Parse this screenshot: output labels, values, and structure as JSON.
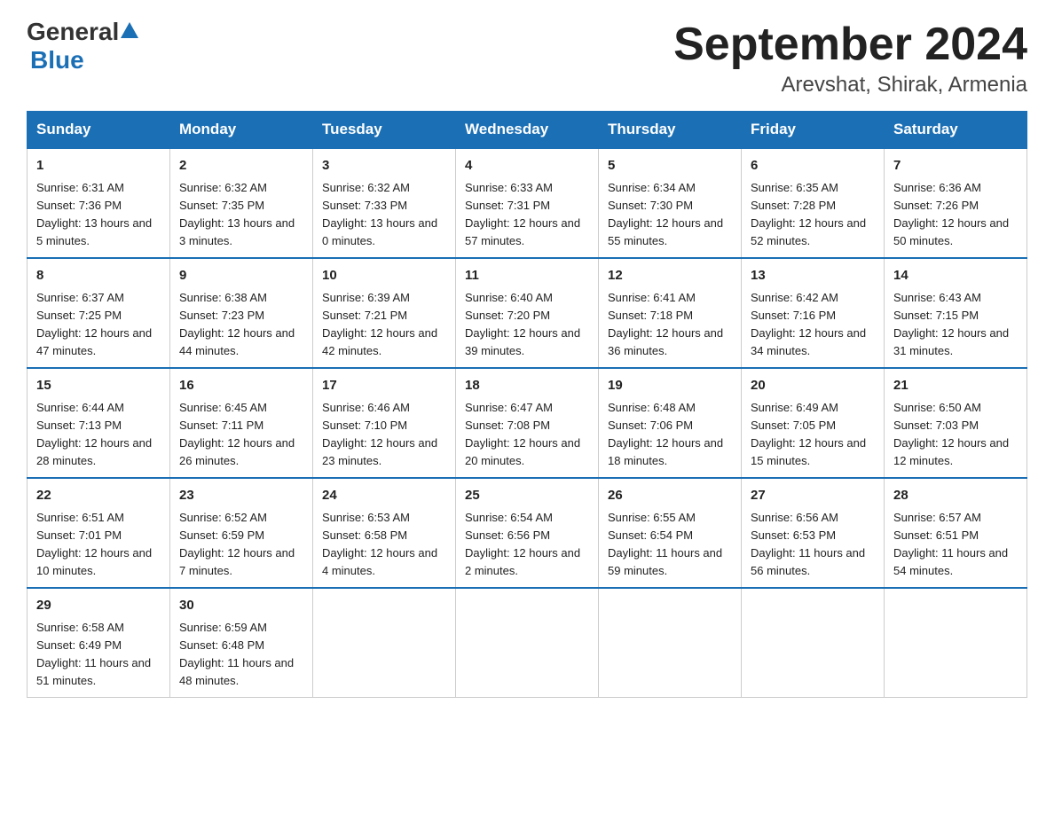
{
  "logo": {
    "general": "General",
    "triangle_symbol": "▶",
    "blue": "Blue"
  },
  "title": {
    "month_year": "September 2024",
    "location": "Arevshat, Shirak, Armenia"
  },
  "weekdays": [
    "Sunday",
    "Monday",
    "Tuesday",
    "Wednesday",
    "Thursday",
    "Friday",
    "Saturday"
  ],
  "weeks": [
    [
      {
        "day": "1",
        "sunrise": "6:31 AM",
        "sunset": "7:36 PM",
        "daylight": "13 hours and 5 minutes."
      },
      {
        "day": "2",
        "sunrise": "6:32 AM",
        "sunset": "7:35 PM",
        "daylight": "13 hours and 3 minutes."
      },
      {
        "day": "3",
        "sunrise": "6:32 AM",
        "sunset": "7:33 PM",
        "daylight": "13 hours and 0 minutes."
      },
      {
        "day": "4",
        "sunrise": "6:33 AM",
        "sunset": "7:31 PM",
        "daylight": "12 hours and 57 minutes."
      },
      {
        "day": "5",
        "sunrise": "6:34 AM",
        "sunset": "7:30 PM",
        "daylight": "12 hours and 55 minutes."
      },
      {
        "day": "6",
        "sunrise": "6:35 AM",
        "sunset": "7:28 PM",
        "daylight": "12 hours and 52 minutes."
      },
      {
        "day": "7",
        "sunrise": "6:36 AM",
        "sunset": "7:26 PM",
        "daylight": "12 hours and 50 minutes."
      }
    ],
    [
      {
        "day": "8",
        "sunrise": "6:37 AM",
        "sunset": "7:25 PM",
        "daylight": "12 hours and 47 minutes."
      },
      {
        "day": "9",
        "sunrise": "6:38 AM",
        "sunset": "7:23 PM",
        "daylight": "12 hours and 44 minutes."
      },
      {
        "day": "10",
        "sunrise": "6:39 AM",
        "sunset": "7:21 PM",
        "daylight": "12 hours and 42 minutes."
      },
      {
        "day": "11",
        "sunrise": "6:40 AM",
        "sunset": "7:20 PM",
        "daylight": "12 hours and 39 minutes."
      },
      {
        "day": "12",
        "sunrise": "6:41 AM",
        "sunset": "7:18 PM",
        "daylight": "12 hours and 36 minutes."
      },
      {
        "day": "13",
        "sunrise": "6:42 AM",
        "sunset": "7:16 PM",
        "daylight": "12 hours and 34 minutes."
      },
      {
        "day": "14",
        "sunrise": "6:43 AM",
        "sunset": "7:15 PM",
        "daylight": "12 hours and 31 minutes."
      }
    ],
    [
      {
        "day": "15",
        "sunrise": "6:44 AM",
        "sunset": "7:13 PM",
        "daylight": "12 hours and 28 minutes."
      },
      {
        "day": "16",
        "sunrise": "6:45 AM",
        "sunset": "7:11 PM",
        "daylight": "12 hours and 26 minutes."
      },
      {
        "day": "17",
        "sunrise": "6:46 AM",
        "sunset": "7:10 PM",
        "daylight": "12 hours and 23 minutes."
      },
      {
        "day": "18",
        "sunrise": "6:47 AM",
        "sunset": "7:08 PM",
        "daylight": "12 hours and 20 minutes."
      },
      {
        "day": "19",
        "sunrise": "6:48 AM",
        "sunset": "7:06 PM",
        "daylight": "12 hours and 18 minutes."
      },
      {
        "day": "20",
        "sunrise": "6:49 AM",
        "sunset": "7:05 PM",
        "daylight": "12 hours and 15 minutes."
      },
      {
        "day": "21",
        "sunrise": "6:50 AM",
        "sunset": "7:03 PM",
        "daylight": "12 hours and 12 minutes."
      }
    ],
    [
      {
        "day": "22",
        "sunrise": "6:51 AM",
        "sunset": "7:01 PM",
        "daylight": "12 hours and 10 minutes."
      },
      {
        "day": "23",
        "sunrise": "6:52 AM",
        "sunset": "6:59 PM",
        "daylight": "12 hours and 7 minutes."
      },
      {
        "day": "24",
        "sunrise": "6:53 AM",
        "sunset": "6:58 PM",
        "daylight": "12 hours and 4 minutes."
      },
      {
        "day": "25",
        "sunrise": "6:54 AM",
        "sunset": "6:56 PM",
        "daylight": "12 hours and 2 minutes."
      },
      {
        "day": "26",
        "sunrise": "6:55 AM",
        "sunset": "6:54 PM",
        "daylight": "11 hours and 59 minutes."
      },
      {
        "day": "27",
        "sunrise": "6:56 AM",
        "sunset": "6:53 PM",
        "daylight": "11 hours and 56 minutes."
      },
      {
        "day": "28",
        "sunrise": "6:57 AM",
        "sunset": "6:51 PM",
        "daylight": "11 hours and 54 minutes."
      }
    ],
    [
      {
        "day": "29",
        "sunrise": "6:58 AM",
        "sunset": "6:49 PM",
        "daylight": "11 hours and 51 minutes."
      },
      {
        "day": "30",
        "sunrise": "6:59 AM",
        "sunset": "6:48 PM",
        "daylight": "11 hours and 48 minutes."
      },
      null,
      null,
      null,
      null,
      null
    ]
  ]
}
